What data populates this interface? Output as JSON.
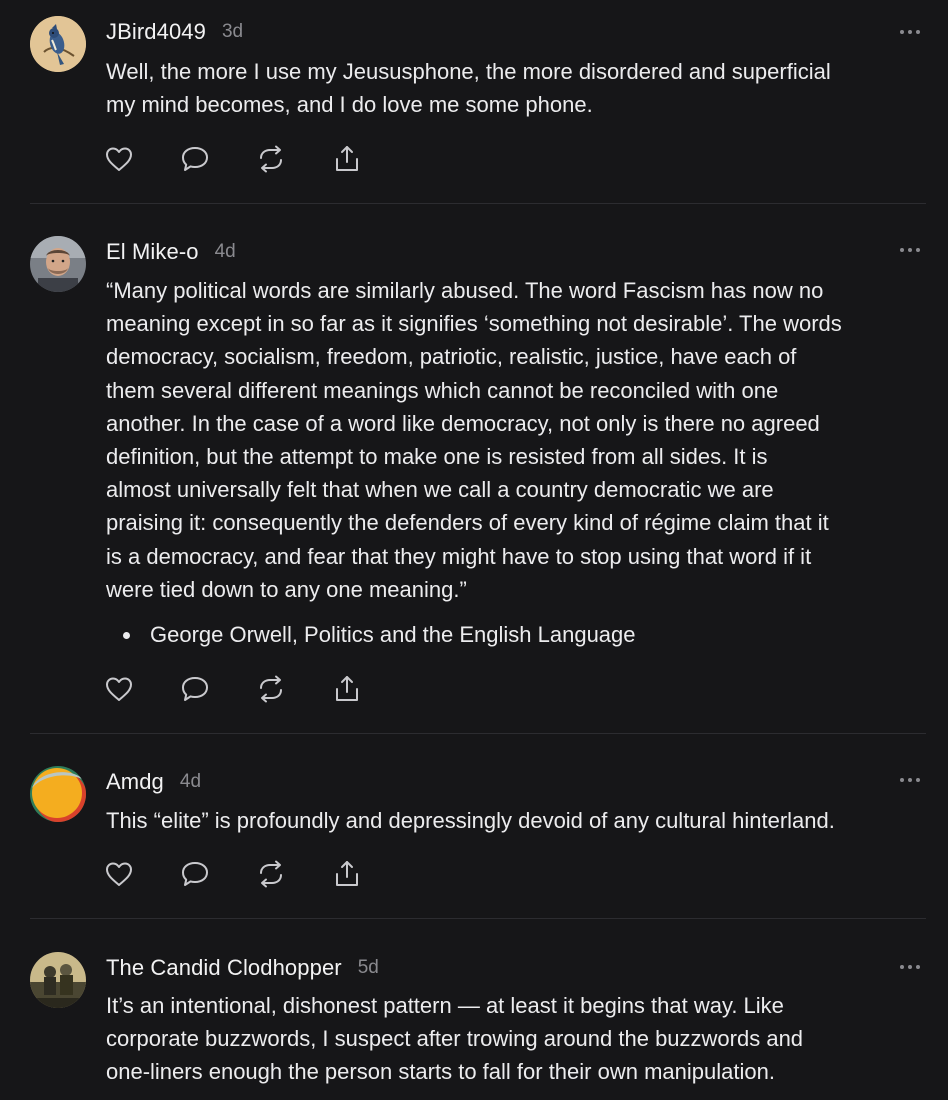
{
  "comments": [
    {
      "author": "JBird4049",
      "age": "3d",
      "avatar_icon": "blue-jay-avatar",
      "lines": [
        "Well, the more I use my Jeususphone, the more disordered and superficial",
        "my mind becomes, and I do love me some phone."
      ]
    },
    {
      "author": "El Mike-o",
      "age": "4d",
      "avatar_icon": "man-photo-avatar",
      "lines": [
        "“Many political words are similarly abused. The word Fascism has now no",
        "meaning except in so far as it signifies ‘something not desirable’. The words",
        "democracy, socialism, freedom, patriotic, realistic, justice, have each of",
        "them several different meanings which cannot be reconciled with one",
        "another. In the case of a word like democracy, not only is there no agreed",
        "definition, but the attempt to make one is resisted from all sides. It is",
        "almost universally felt that when we call a country democratic we are",
        "praising it: consequently the defenders of every kind of régime claim that it",
        "is a democracy, and fear that they might have to stop using that word if it",
        "were tied down to any one meaning.”"
      ],
      "bullet": "George Orwell, Politics and the English Language"
    },
    {
      "author": "Amdg",
      "age": "4d",
      "avatar_icon": "orange-circle-avatar",
      "lines": [
        "This “elite” is profoundly and depressingly devoid of any cultural hinterland."
      ]
    },
    {
      "author": "The Candid Clodhopper",
      "age": "5d",
      "avatar_icon": "figures-photo-avatar",
      "lines": [
        "It’s an intentional, dishonest pattern — at least it begins that way. Like",
        "corporate buzzwords, I suspect after trowing around the buzzwords and",
        "one-liners enough the person starts to fall for their own manipulation."
      ]
    }
  ],
  "action_icons": [
    "heart-icon",
    "comment-icon",
    "restack-icon",
    "share-icon"
  ],
  "colors": {
    "background": "#161618",
    "text": "#ececee",
    "muted": "#8a8a8f",
    "divider": "#2c2c30"
  }
}
